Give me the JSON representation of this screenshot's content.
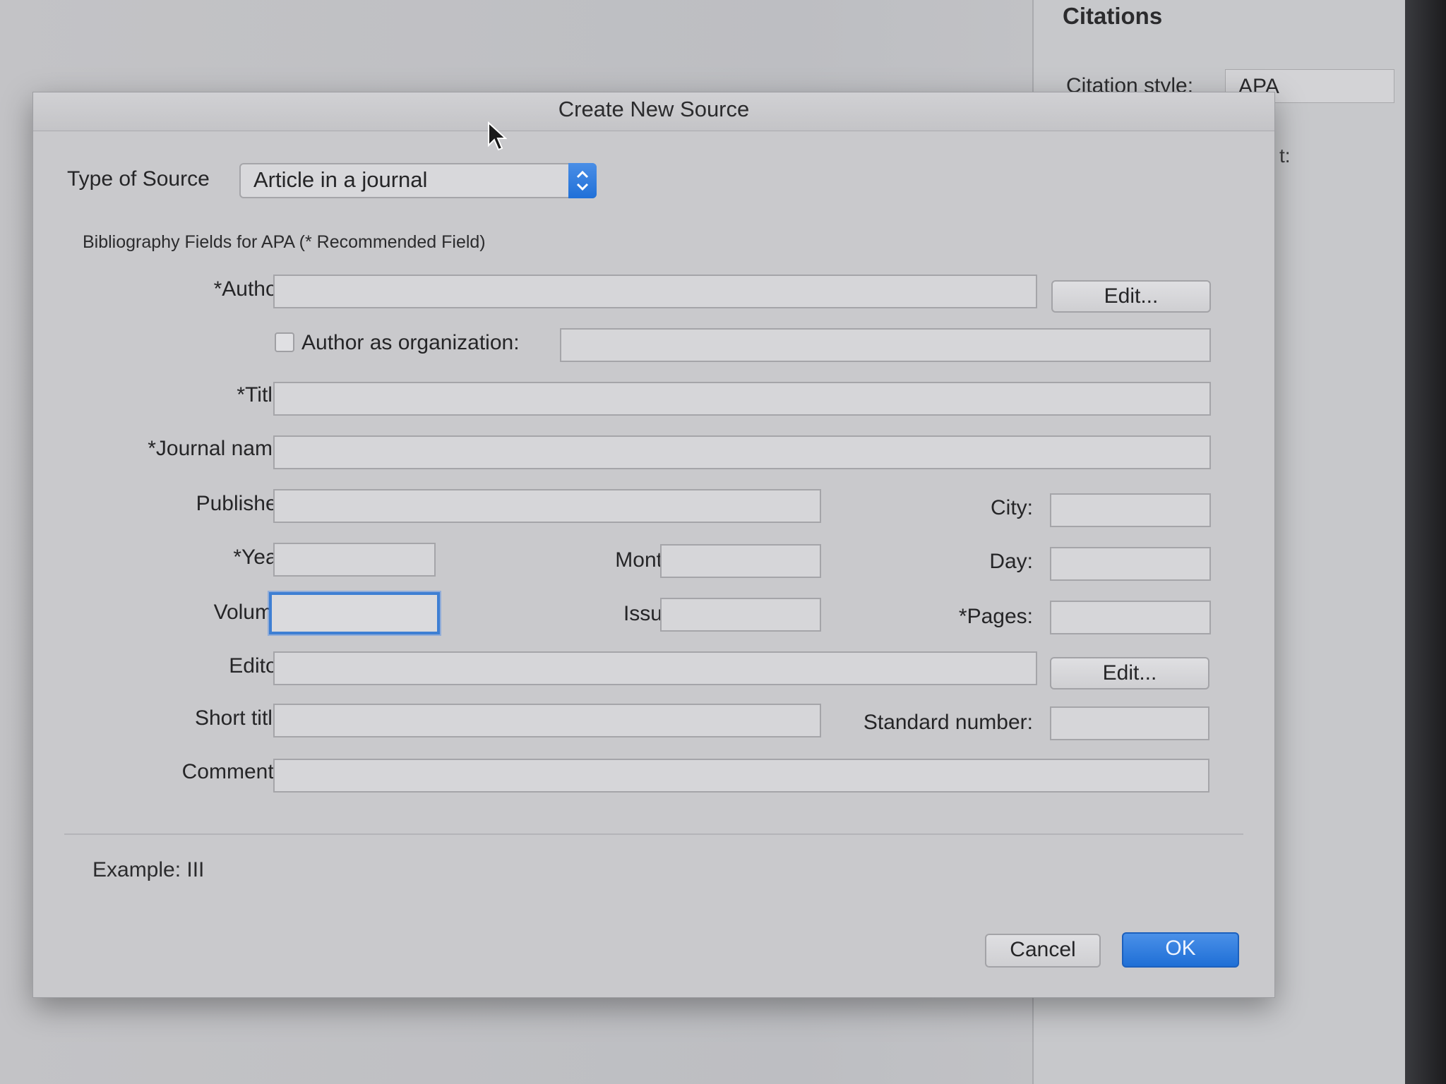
{
  "background": {
    "citations_title": "Citations",
    "citation_style_label": "Citation style:",
    "citation_style_value": "APA",
    "pane_fragment": "t:"
  },
  "dialog": {
    "title": "Create New Source",
    "type_of_source_label": "Type of Source",
    "type_of_source_value": "Article in a journal",
    "fields_caption": "Bibliography Fields for APA  (* Recommended Field)",
    "labels": {
      "author": "*Author:",
      "author_org": "Author as organization:",
      "title": "*Title:",
      "journal": "*Journal name:",
      "publisher": "Publisher:",
      "city": "City:",
      "year": "*Year:",
      "month": "Month:",
      "day": "Day:",
      "volume": "Volume:",
      "issue": "Issue:",
      "pages": "*Pages:",
      "editor": "Editor:",
      "short_title": "Short title:",
      "standard_number": "Standard number:",
      "comments": "Comments:"
    },
    "values": {
      "author": "",
      "author_org": "",
      "title": "",
      "journal": "",
      "publisher": "",
      "city": "",
      "year": "",
      "month": "",
      "day": "",
      "volume": "",
      "issue": "",
      "pages": "",
      "editor": "",
      "short_title": "",
      "standard_number": "",
      "comments": ""
    },
    "author_org_checked": false,
    "edit_author_label": "Edit...",
    "edit_editor_label": "Edit...",
    "example": "Example: III",
    "cancel_label": "Cancel",
    "ok_label": "OK"
  },
  "colors": {
    "accent": "#2a78dc",
    "dialog_bg": "#c9c9cc"
  },
  "icons": [
    "mouse-cursor-icon",
    "select-arrows-icon",
    "checkbox-icon"
  ]
}
